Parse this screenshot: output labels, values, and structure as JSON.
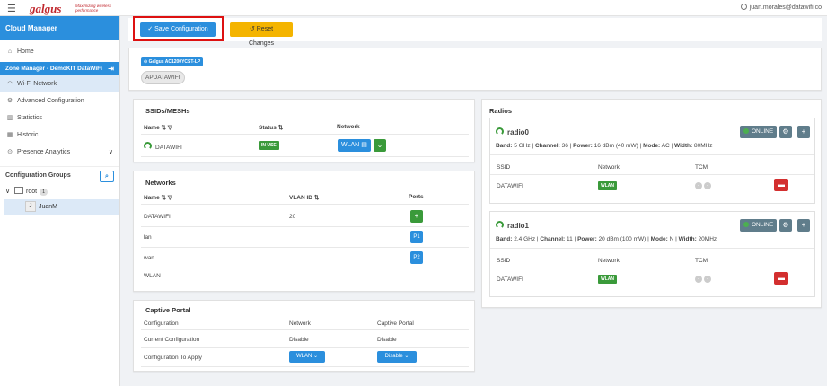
{
  "topbar": {
    "logo": "galgus",
    "tagline": "Maximizing wireless performance",
    "user_email": "juan.morales@datawifi.co"
  },
  "sidebar": {
    "title": "Cloud Manager",
    "home": "Home",
    "zone": "Zone Manager - DemoKIT DataWiFi",
    "items": [
      "Wi-Fi Network",
      "Advanced Configuration",
      "Statistics",
      "Historic",
      "Presence Analytics"
    ],
    "config_groups": "Configuration Groups",
    "tree_root": "root",
    "tree_root_count": "1",
    "tree_child": "JuanM",
    "tree_child_avatar": "J"
  },
  "toolbar": {
    "save_label": "Save Configuration",
    "reset_label": "Reset Changes"
  },
  "device": {
    "badge": "Galgus AC1200YCST-LP",
    "ap_chip": "APDATAWIFI"
  },
  "ssids": {
    "title": "SSIDs/MESHs",
    "col_name": "Name",
    "col_status": "Status",
    "col_network": "Network",
    "row_name": "DATAWIFI",
    "row_status": "IN USE",
    "row_network": "WLAN"
  },
  "networks": {
    "title": "Networks",
    "col_name": "Name",
    "col_vlan": "VLAN ID",
    "col_ports": "Ports",
    "rows": [
      {
        "name": "DATAWIFI",
        "vlan": "20",
        "port": "+"
      },
      {
        "name": "lan",
        "vlan": "",
        "port": "P1"
      },
      {
        "name": "wan",
        "vlan": "",
        "port": "P2"
      },
      {
        "name": "WLAN",
        "vlan": "",
        "port": ""
      }
    ]
  },
  "captive": {
    "title": "Captive Portal",
    "col_config": "Configuration",
    "col_network": "Network",
    "col_portal": "Captive Portal",
    "row1_label": "Current Configuration",
    "row1_network": "Disable",
    "row1_portal": "Disable",
    "row2_label": "Configuration To Apply",
    "row2_network": "WLAN",
    "row2_portal": "Disable"
  },
  "radios": {
    "title": "Radios",
    "col_ssid": "SSID",
    "col_network": "Network",
    "col_tcm": "TCM",
    "online_label": "ONLINE",
    "items": [
      {
        "name": "radio0",
        "band_label": "Band:",
        "band": "5 GHz",
        "channel_label": "Channel:",
        "channel": "36",
        "power_label": "Power:",
        "power": "16 dBm (40 mW)",
        "mode_label": "Mode:",
        "mode": "AC",
        "width_label": "Width:",
        "width": "80MHz",
        "ssid": "DATAWIFI",
        "network": "WLAN"
      },
      {
        "name": "radio1",
        "band_label": "Band:",
        "band": "2.4 GHz",
        "channel_label": "Channel:",
        "channel": "11",
        "power_label": "Power:",
        "power": "20 dBm (100 mW)",
        "mode_label": "Mode:",
        "mode": "N",
        "width_label": "Width:",
        "width": "20MHz",
        "ssid": "DATAWIFI",
        "network": "WLAN"
      }
    ]
  }
}
